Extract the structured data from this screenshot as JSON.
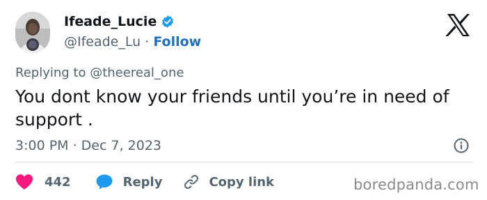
{
  "author": {
    "display_name": "Ifeade_Lucie",
    "handle": "@Ifeade_Lu",
    "separator": "·",
    "follow_label": "Follow",
    "verified_icon": "verified-badge-icon",
    "verified_color": "#1d9bf0"
  },
  "platform_logo": "x-logo-icon",
  "reply_context": "Replying to @theereal_one",
  "tweet": {
    "text": "You dont know your friends until you’re in need of support ."
  },
  "meta": {
    "timestamp": "3:00 PM · Dec 7, 2023",
    "info_icon": "info-icon"
  },
  "actions": {
    "like_count": "442",
    "like_icon": "heart-icon",
    "like_color": "#f91880",
    "reply_label": "Reply",
    "reply_icon": "speech-bubble-icon",
    "reply_color": "#1d9bf0",
    "copy_label": "Copy link",
    "copy_icon": "link-icon"
  },
  "watermark": "boredpanda.com",
  "colors": {
    "text": "#0f1419",
    "secondary": "#536471",
    "follow": "#1d6fbf"
  }
}
